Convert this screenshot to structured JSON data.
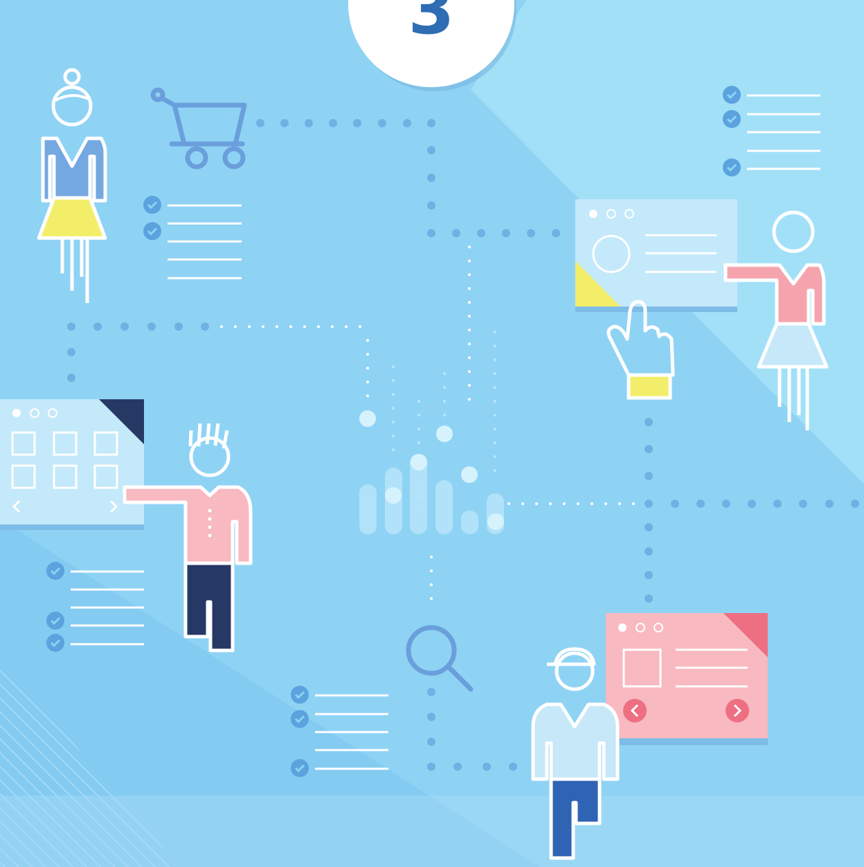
{
  "badge": {
    "number": "3"
  },
  "colors": {
    "background": "#8fd3f4",
    "background_light": "#a2e0f8",
    "shadow": "#78c3ec",
    "dot": "#6fb1e3",
    "line": "#ffffff",
    "check_circle": "#5aa3de",
    "icon_stroke": "#6a9fdc",
    "pink": "#f5a4ae",
    "pink_light": "#f8b9c0",
    "pink_dark": "#ee6f82",
    "yellow": "#f3ee6a",
    "navy": "#263965",
    "blue_pants": "#2f63b3",
    "blouse_blue": "#74a8e0",
    "light_shirt": "#c6e8f8",
    "badge_text": "#2e6db4"
  },
  "icons": [
    "shopping-cart-icon",
    "search-icon",
    "pointing-hand-icon",
    "check-icon",
    "chevron-left-icon",
    "chevron-right-icon",
    "bar-chart-icon"
  ]
}
